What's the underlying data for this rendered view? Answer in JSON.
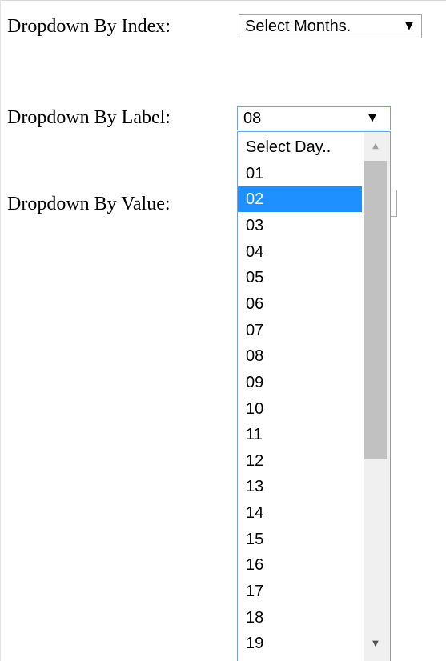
{
  "form": {
    "index_label": "Dropdown By Index:",
    "index_selected": "Select Months.",
    "label_label": "Dropdown By Label:",
    "label_selected": "08",
    "value_label": "Dropdown By Value:"
  },
  "dropdown": {
    "highlighted_value": "02",
    "options": [
      "Select Day..",
      "01",
      "02",
      "03",
      "04",
      "05",
      "06",
      "07",
      "08",
      "09",
      "10",
      "11",
      "12",
      "13",
      "14",
      "15",
      "16",
      "17",
      "18",
      "19"
    ]
  },
  "icons": {
    "select_arrow": "▼",
    "scroll_up": "▲",
    "scroll_down": "▼"
  }
}
